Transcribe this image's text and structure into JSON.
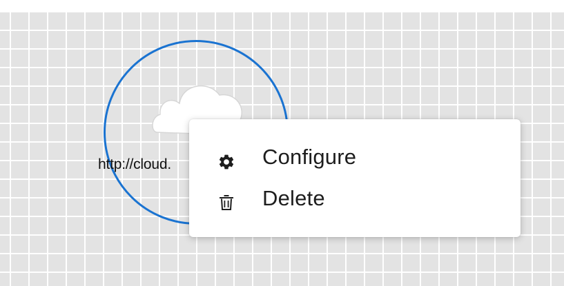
{
  "canvas": {
    "background": "#e3e3e3",
    "grid_line_color": "#ffffff"
  },
  "node": {
    "icon": "cloud-icon",
    "label": "http://cloud.",
    "ring_color": "#1a73d1"
  },
  "context_menu": {
    "items": [
      {
        "label": "Configure",
        "icon": "gear-icon"
      },
      {
        "label": "Delete",
        "icon": "trash-icon"
      }
    ]
  }
}
